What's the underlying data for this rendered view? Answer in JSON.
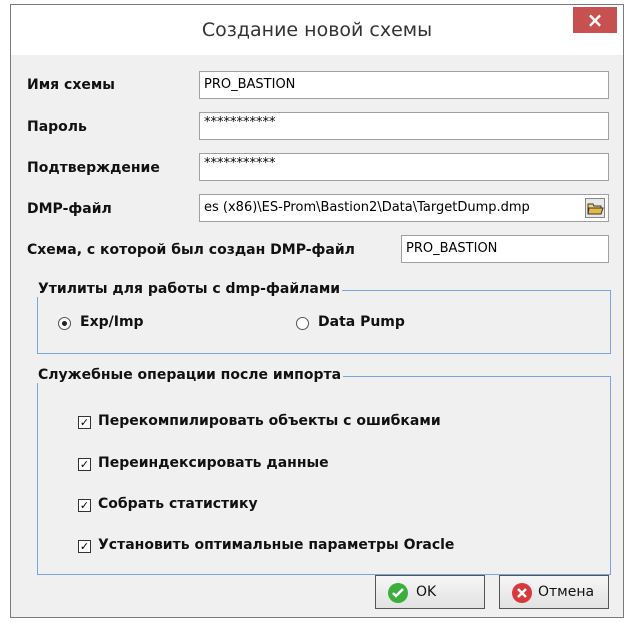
{
  "window": {
    "title": "Создание новой схемы",
    "close_glyph": "×"
  },
  "form": {
    "schema_name": {
      "label": "Имя схемы",
      "value": "PRO_BASTION"
    },
    "password": {
      "label": "Пароль",
      "value": "***********"
    },
    "confirm": {
      "label": "Подтверждение",
      "value": "***********"
    },
    "dmp_file": {
      "label": "DMP-файл",
      "value": "es (x86)\\ES-Prom\\Bastion2\\Data\\TargetDump.dmp",
      "browse_icon": "folder-open-icon"
    },
    "source_schema": {
      "label": "Схема, с которой был создан DMP-файл",
      "value": "PRO_BASTION"
    }
  },
  "utilities": {
    "title": "Утилиты для работы с dmp-файлами",
    "options": [
      {
        "label": "Exp/Imp",
        "selected": true
      },
      {
        "label": "Data Pump",
        "selected": false
      }
    ]
  },
  "post_import": {
    "title": "Служебные операции после импорта",
    "items": [
      {
        "label": "Перекомпилировать объекты с ошибками",
        "checked": true
      },
      {
        "label": "Переиндексировать данные",
        "checked": true
      },
      {
        "label": "Собрать статистику",
        "checked": true
      },
      {
        "label": "Установить оптимальные параметры Oracle",
        "checked": true
      }
    ]
  },
  "buttons": {
    "ok": {
      "label": "OK",
      "icon": "check-circle-icon",
      "color": "#3cae3c"
    },
    "cancel": {
      "label": "Отмена",
      "icon": "cancel-circle-icon",
      "color": "#d8393c"
    }
  },
  "check_glyph": "✓"
}
